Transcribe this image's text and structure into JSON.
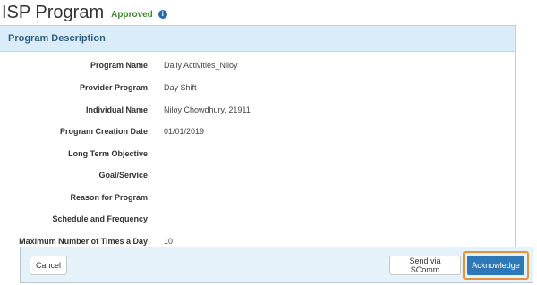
{
  "header": {
    "title": "ISP Program",
    "status": "Approved",
    "info_icon": "i"
  },
  "panel": {
    "heading": "Program Description",
    "fields": [
      {
        "label": "Program Name",
        "value": "Daily Activities_Niloy"
      },
      {
        "label": "Provider Program",
        "value": "Day Shift"
      },
      {
        "label": "Individual Name",
        "value": "Niloy Chowdhury, 21911"
      },
      {
        "label": "Program Creation Date",
        "value": "01/01/2019"
      },
      {
        "label": "Long Term Objective",
        "value": ""
      },
      {
        "label": "Goal/Service",
        "value": ""
      },
      {
        "label": "Reason for Program",
        "value": ""
      },
      {
        "label": "Schedule and Frequency",
        "value": ""
      },
      {
        "label": "Maximum Number of Times a Day",
        "value": "10"
      }
    ]
  },
  "footer": {
    "cancel_label": "Cancel",
    "send_label": "Send via SComm",
    "acknowledge_label": "Acknowledge"
  },
  "colors": {
    "accent": "#2f78b8",
    "highlight": "#e8903a",
    "status": "#3c8a2e"
  }
}
